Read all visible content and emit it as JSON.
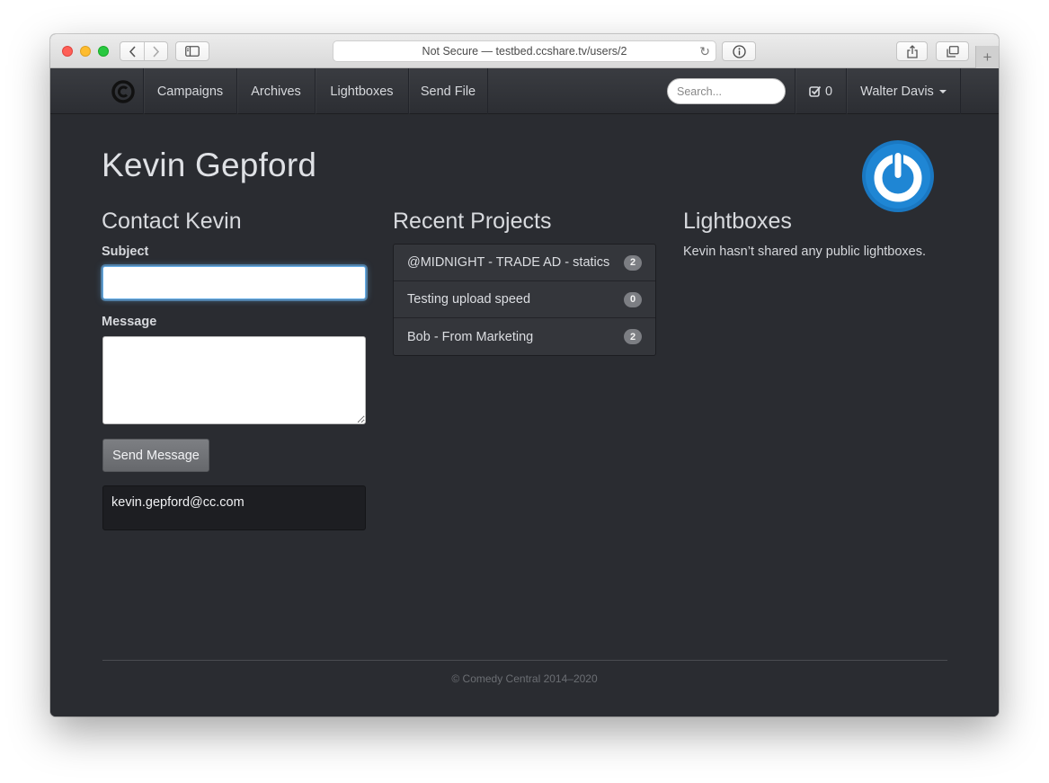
{
  "browser": {
    "url_text": "Not Secure — testbed.ccshare.tv/users/2",
    "new_tab_symbol": "+"
  },
  "navbar": {
    "brand_icon": "comedy-central-logo",
    "items": [
      {
        "label": "Campaigns"
      },
      {
        "label": "Archives"
      },
      {
        "label": "Lightboxes"
      },
      {
        "label": "Send File"
      }
    ],
    "search_placeholder": "Search...",
    "task_count": "0",
    "user_name": "Walter Davis"
  },
  "profile": {
    "name": "Kevin Gepford",
    "avatar_icon": "power-logo",
    "avatar_color": "#1a78c2"
  },
  "contact": {
    "title": "Contact Kevin",
    "subject_label": "Subject",
    "subject_value": "",
    "message_label": "Message",
    "message_value": "",
    "send_label": "Send Message",
    "email": "kevin.gepford@cc.com"
  },
  "projects": {
    "title": "Recent Projects",
    "items": [
      {
        "name": "@MIDNIGHT - TRADE AD - statics",
        "count": "2"
      },
      {
        "name": "Testing upload speed",
        "count": "0"
      },
      {
        "name": "Bob - From Marketing",
        "count": "2"
      }
    ]
  },
  "lightboxes": {
    "title": "Lightboxes",
    "empty_text": "Kevin hasn’t shared any public lightboxes."
  },
  "footer": {
    "text": "© Comedy Central 2014–2020"
  }
}
